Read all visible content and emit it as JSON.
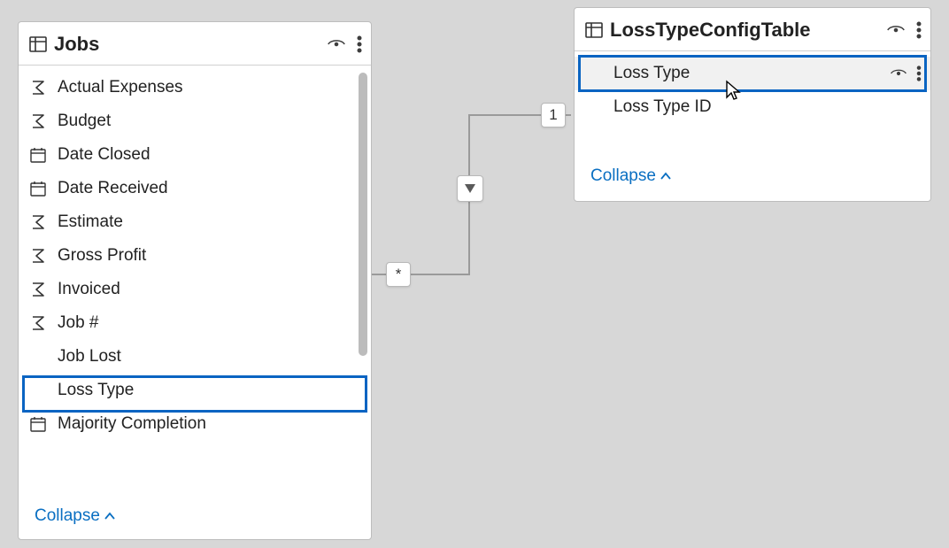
{
  "jobs_card": {
    "title": "Jobs",
    "collapse_label": "Collapse",
    "fields": {
      "actual_expenses": "Actual Expenses",
      "budget": "Budget",
      "date_closed": "Date Closed",
      "date_received": "Date Received",
      "estimate": "Estimate",
      "gross_profit": "Gross Profit",
      "invoiced": "Invoiced",
      "job_number": "Job #",
      "job_lost": "Job Lost",
      "loss_type": "Loss Type",
      "majority_completion": "Majority Completion"
    }
  },
  "config_card": {
    "title": "LossTypeConfigTable",
    "collapse_label": "Collapse",
    "fields": {
      "loss_type": "Loss Type",
      "loss_type_id": "Loss Type ID"
    }
  },
  "relationship": {
    "many_label": "*",
    "one_label": "1"
  }
}
